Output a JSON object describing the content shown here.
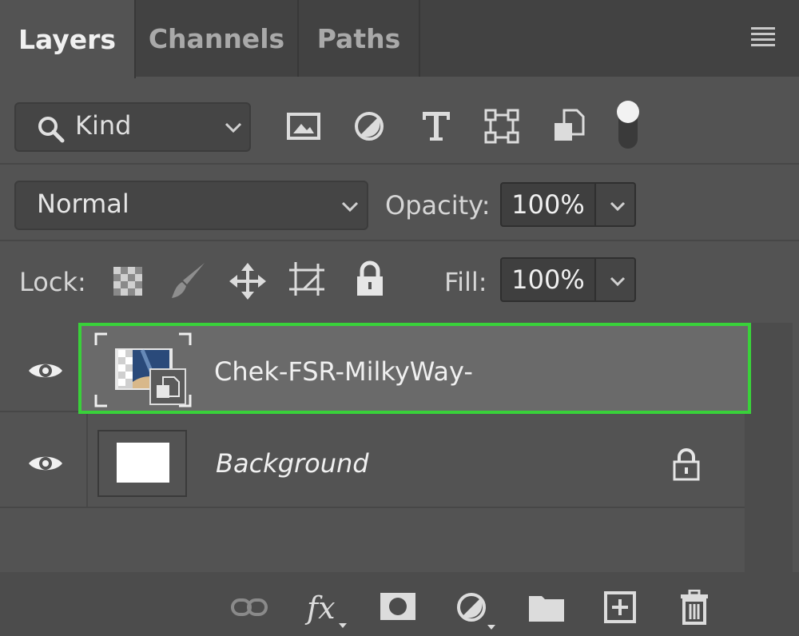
{
  "tabs": [
    {
      "label": "Layers",
      "active": true
    },
    {
      "label": "Channels",
      "active": false
    },
    {
      "label": "Paths",
      "active": false
    }
  ],
  "filter": {
    "kind_label": "Kind",
    "filter_icons": [
      "image-filter-icon",
      "adjustment-filter-icon",
      "type-filter-icon",
      "shape-filter-icon",
      "smart-object-filter-icon",
      "filter-toggle-icon"
    ]
  },
  "blend": {
    "mode": "Normal",
    "opacity_label": "Opacity:",
    "opacity_value": "100%"
  },
  "lock": {
    "label": "Lock:",
    "icons": [
      "lock-transparent-pixels-icon",
      "lock-image-pixels-icon",
      "lock-position-icon",
      "lock-artboard-icon",
      "lock-all-icon"
    ],
    "fill_label": "Fill:",
    "fill_value": "100%"
  },
  "layers": [
    {
      "name": "Chek-FSR-MilkyWay-",
      "type": "smart-object",
      "selected": true,
      "visible": true,
      "locked": false
    },
    {
      "name": "Background",
      "type": "background",
      "selected": false,
      "visible": true,
      "locked": true
    }
  ],
  "bottom_icons": [
    "link-layers-icon",
    "fx-icon",
    "add-mask-icon",
    "adjustment-layer-icon",
    "new-group-icon",
    "new-layer-icon",
    "delete-layer-icon"
  ],
  "colors": {
    "panel_bg": "#535353",
    "selection_outline": "#39d13a",
    "selected_row": "#6a6a6a"
  }
}
